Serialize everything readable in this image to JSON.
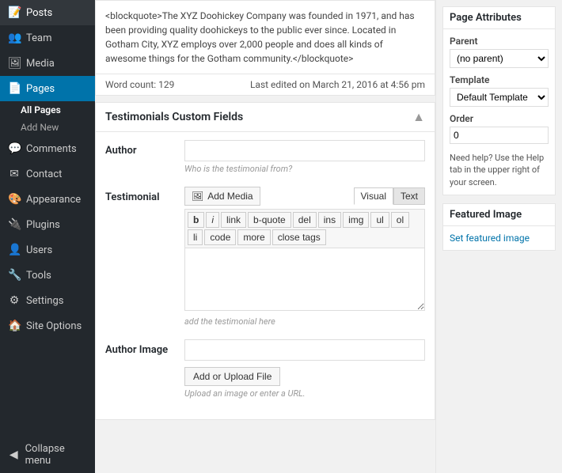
{
  "sidebar": {
    "items": [
      {
        "id": "posts",
        "label": "Posts",
        "icon": "📝",
        "active": false
      },
      {
        "id": "team",
        "label": "Team",
        "icon": "👥",
        "active": false
      },
      {
        "id": "media",
        "label": "Media",
        "icon": "🖼",
        "active": false
      },
      {
        "id": "pages",
        "label": "Pages",
        "icon": "📄",
        "active": true
      },
      {
        "id": "comments",
        "label": "Comments",
        "icon": "💬",
        "active": false
      },
      {
        "id": "contact",
        "label": "Contact",
        "icon": "✉",
        "active": false
      },
      {
        "id": "appearance",
        "label": "Appearance",
        "icon": "🎨",
        "active": false
      },
      {
        "id": "plugins",
        "label": "Plugins",
        "icon": "🔌",
        "active": false
      },
      {
        "id": "users",
        "label": "Users",
        "icon": "👤",
        "active": false
      },
      {
        "id": "tools",
        "label": "Tools",
        "icon": "🔧",
        "active": false
      },
      {
        "id": "settings",
        "label": "Settings",
        "icon": "⚙",
        "active": false
      },
      {
        "id": "siteoptions",
        "label": "Site Options",
        "icon": "🏠",
        "active": false
      }
    ],
    "subitems": [
      {
        "label": "All Pages",
        "active": true
      },
      {
        "label": "Add New",
        "active": false
      }
    ],
    "collapse": "Collapse menu"
  },
  "blockquote": {
    "text": "<blockquote>The XYZ Doohickey Company was founded in 1971, and has been providing quality doohickeys to the public ever since. Located in Gotham City, XYZ employs over 2,000 people and does all kinds of awesome things for the Gotham community.</blockquote>"
  },
  "wordcount": {
    "label": "Word count: 129",
    "lastedited": "Last edited on March 21, 2016 at 4:56 pm"
  },
  "customfields": {
    "title": "Testimonials Custom Fields",
    "author": {
      "label": "Author",
      "placeholder": "",
      "hint": "Who is the testimonial from?"
    },
    "testimonial": {
      "label": "Testimonial",
      "addmedia": "Add Media",
      "visual": "Visual",
      "text": "Text",
      "formatting": [
        "b",
        "i",
        "link",
        "b-quote",
        "del",
        "ins",
        "img",
        "ul",
        "ol",
        "li",
        "code",
        "more",
        "close tags"
      ],
      "placeholder": "add the testimonial here"
    },
    "authorimage": {
      "label": "Author Image",
      "placeholder": "",
      "uploadbtn": "Add or Upload File",
      "hint": "Upload an image or enter a URL."
    }
  },
  "rightsidebar": {
    "parentbox": {
      "title": "Page Attributes",
      "parent_label": "(no parent)",
      "template_label": "Template",
      "template_value": "Default Template",
      "order_label": "Order",
      "order_value": "0",
      "help_text": "Need help? Use the Help tab in the upper right of your screen."
    },
    "featuredimage": {
      "title": "Featured Image",
      "setlink": "Set featured image"
    }
  }
}
